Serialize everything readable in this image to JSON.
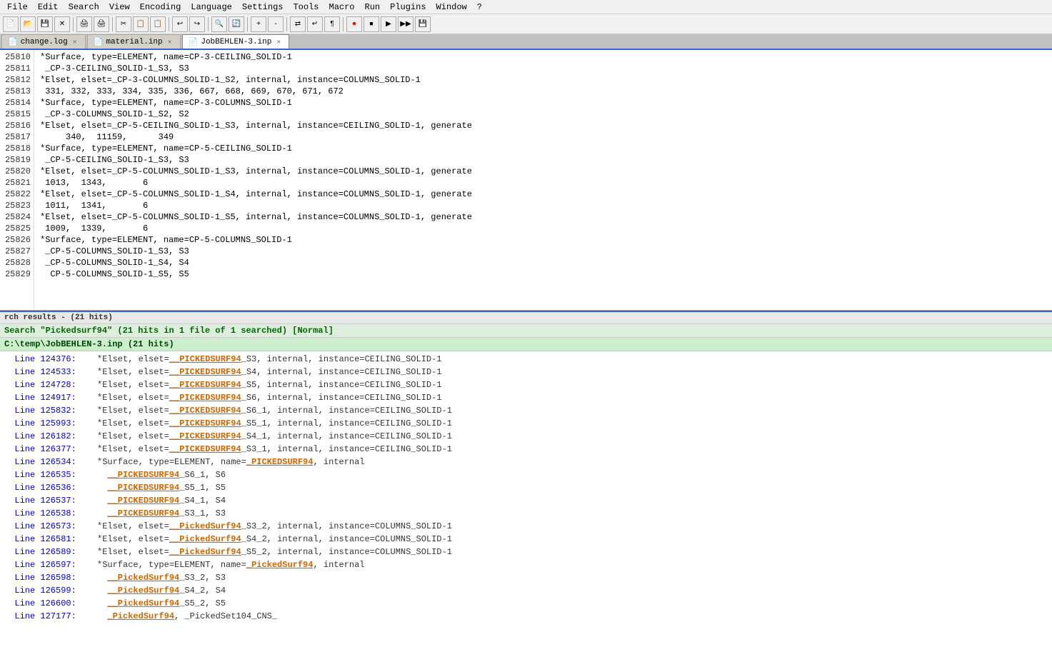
{
  "menubar": {
    "items": [
      "File",
      "Edit",
      "Search",
      "View",
      "Encoding",
      "Language",
      "Settings",
      "Tools",
      "Macro",
      "Run",
      "Plugins",
      "Window",
      "?"
    ]
  },
  "tabs": [
    {
      "id": "tab-changelog",
      "label": "change.log",
      "active": false,
      "icon": "📄"
    },
    {
      "id": "tab-material",
      "label": "material.inp",
      "active": false,
      "icon": "📄"
    },
    {
      "id": "tab-jobbehlen",
      "label": "JobBEHLEN-3.inp",
      "active": true,
      "icon": "📄"
    }
  ],
  "editor": {
    "lines": [
      {
        "num": "25810",
        "text": "*Surface, type=ELEMENT, name=CP-3-CEILING_SOLID-1"
      },
      {
        "num": "25811",
        "text": " _CP-3-CEILING_SOLID-1_S3, S3"
      },
      {
        "num": "25812",
        "text": "*Elset, elset=_CP-3-COLUMNS_SOLID-1_S2, internal, instance=COLUMNS_SOLID-1"
      },
      {
        "num": "25813",
        "text": " 331, 332, 333, 334, 335, 336, 667, 668, 669, 670, 671, 672"
      },
      {
        "num": "25814",
        "text": "*Surface, type=ELEMENT, name=CP-3-COLUMNS_SOLID-1"
      },
      {
        "num": "25815",
        "text": " _CP-3-COLUMNS_SOLID-1_S2, S2"
      },
      {
        "num": "25816",
        "text": "*Elset, elset=_CP-5-CEILING_SOLID-1_S3, internal, instance=CEILING_SOLID-1, generate"
      },
      {
        "num": "25817",
        "text": "    340,  11159,      349"
      },
      {
        "num": "25818",
        "text": "*Surface, type=ELEMENT, name=CP-5-CEILING_SOLID-1"
      },
      {
        "num": "25819",
        "text": " _CP-5-CEILING_SOLID-1_S3, S3"
      },
      {
        "num": "25820",
        "text": "*Elset, elset=_CP-5-COLUMNS_SOLID-1_S3, internal, instance=COLUMNS_SOLID-1, generate"
      },
      {
        "num": "25821",
        "text": " 1013,  1343,       6"
      },
      {
        "num": "25822",
        "text": "*Elset, elset=_CP-5-COLUMNS_SOLID-1_S4, internal, instance=COLUMNS_SOLID-1, generate"
      },
      {
        "num": "25823",
        "text": " 1011,  1341,       6"
      },
      {
        "num": "25824",
        "text": "*Elset, elset=_CP-5-COLUMNS_SOLID-1_S5, internal, instance=COLUMNS_SOLID-1, generate"
      },
      {
        "num": "25825",
        "text": " 1009,  1339,       6"
      },
      {
        "num": "25826",
        "text": "*Surface, type=ELEMENT, name=CP-5-COLUMNS_SOLID-1"
      },
      {
        "num": "25827",
        "text": " _CP-5-COLUMNS_SOLID-1_S3, S3"
      },
      {
        "num": "25828",
        "text": " _CP-5-COLUMNS_SOLID-1_S4, S4"
      },
      {
        "num": "25829",
        "text": "  CP-5-COLUMNS_SOLID-1_S5, S5"
      }
    ]
  },
  "search_panel": {
    "header": "rch results - (21 hits)",
    "query_line": "Search \"Pickedsurf94\" (21 hits in 1 file of 1 searched)  [Normal]",
    "file_line": "  C:\\temp\\JobBEHLEN-3.inp (21 hits)",
    "results": [
      {
        "line_ref": "Line 124376:",
        "prefix": "*Elset, elset=",
        "highlight": "__PICKEDSURF94",
        "suffix": "_S3, internal, instance=CEILING_SOLID-1"
      },
      {
        "line_ref": "Line 124533:",
        "prefix": "*Elset, elset=",
        "highlight": "__PICKEDSURF94",
        "suffix": "_S4, internal, instance=CEILING_SOLID-1"
      },
      {
        "line_ref": "Line 124728:",
        "prefix": "*Elset, elset=",
        "highlight": "__PICKEDSURF94",
        "suffix": "_S5, internal, instance=CEILING_SOLID-1"
      },
      {
        "line_ref": "Line 124917:",
        "prefix": "*Elset, elset=",
        "highlight": "__PICKEDSURF94",
        "suffix": "_S6, internal, instance=CEILING_SOLID-1"
      },
      {
        "line_ref": "Line 125832:",
        "prefix": "*Elset, elset=",
        "highlight": "__PICKEDSURF94",
        "suffix": "_S6_1, internal, instance=CEILING_SOLID-1"
      },
      {
        "line_ref": "Line 125993:",
        "prefix": "*Elset, elset=",
        "highlight": "__PICKEDSURF94",
        "suffix": "_S5_1, internal, instance=CEILING_SOLID-1"
      },
      {
        "line_ref": "Line 126182:",
        "prefix": "*Elset, elset=",
        "highlight": "__PICKEDSURF94",
        "suffix": "_S4_1, internal, instance=CEILING_SOLID-1"
      },
      {
        "line_ref": "Line 126377:",
        "prefix": "*Elset, elset=",
        "highlight": "__PICKEDSURF94",
        "suffix": "_S3_1, internal, instance=CEILING_SOLID-1"
      },
      {
        "line_ref": "Line 126534:",
        "prefix": "*Surface, type=ELEMENT, name=",
        "highlight": "_PICKEDSURF94",
        "suffix": ", internal"
      },
      {
        "line_ref": "Line 126535:",
        "prefix": "  ",
        "highlight": "__PICKEDSURF94",
        "suffix": "_S6_1, S6"
      },
      {
        "line_ref": "Line 126536:",
        "prefix": "  ",
        "highlight": "__PICKEDSURF94",
        "suffix": "_S5_1, S5"
      },
      {
        "line_ref": "Line 126537:",
        "prefix": "  ",
        "highlight": "__PICKEDSURF94",
        "suffix": "_S4_1, S4"
      },
      {
        "line_ref": "Line 126538:",
        "prefix": "  ",
        "highlight": "__PICKEDSURF94",
        "suffix": "_S3_1, S3"
      },
      {
        "line_ref": "Line 126573:",
        "prefix": "*Elset, elset=",
        "highlight": "__PickedSurf94",
        "suffix": "_S3_2, internal, instance=COLUMNS_SOLID-1"
      },
      {
        "line_ref": "Line 126581:",
        "prefix": "*Elset, elset=",
        "highlight": "__PickedSurf94",
        "suffix": "_S4_2, internal, instance=COLUMNS_SOLID-1"
      },
      {
        "line_ref": "Line 126589:",
        "prefix": "*Elset, elset=",
        "highlight": "__PickedSurf94",
        "suffix": "_S5_2, internal, instance=COLUMNS_SOLID-1"
      },
      {
        "line_ref": "Line 126597:",
        "prefix": "*Surface, type=ELEMENT, name=",
        "highlight": "_PickedSurf94",
        "suffix": ", internal"
      },
      {
        "line_ref": "Line 126598:",
        "prefix": "  ",
        "highlight": "__PickedSurf94",
        "suffix": "_S3_2, S3"
      },
      {
        "line_ref": "Line 126599:",
        "prefix": "  ",
        "highlight": "__PickedSurf94",
        "suffix": "_S4_2, S4"
      },
      {
        "line_ref": "Line 126600:",
        "prefix": "  ",
        "highlight": "__PickedSurf94",
        "suffix": "_S5_2, S5"
      },
      {
        "line_ref": "Line 127177:",
        "prefix": "  ",
        "highlight": "_PickedSurf94",
        "suffix": ", _PickedSet104_CNS_"
      }
    ]
  },
  "toolbar": {
    "buttons": [
      "📄",
      "💾",
      "📂",
      "🖨",
      "✂",
      "📋",
      "📋",
      "↩",
      "↪",
      "🔍",
      "🔍",
      "",
      "",
      "",
      "",
      "",
      "",
      "",
      "",
      "",
      "",
      "",
      "",
      "",
      ""
    ]
  }
}
